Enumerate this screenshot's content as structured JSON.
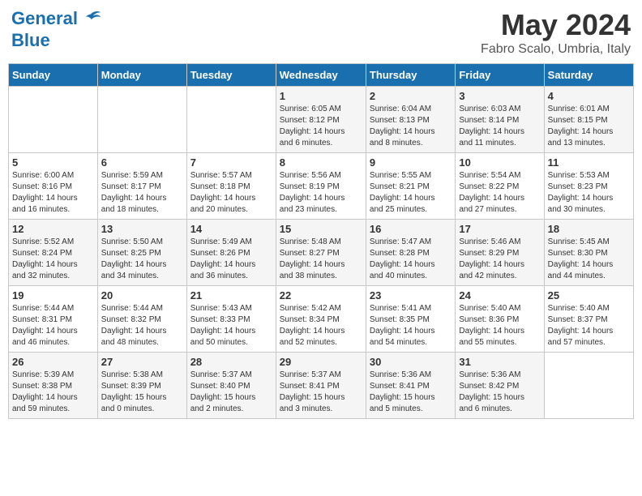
{
  "header": {
    "logo_line1": "General",
    "logo_line2": "Blue",
    "month": "May 2024",
    "location": "Fabro Scalo, Umbria, Italy"
  },
  "days_of_week": [
    "Sunday",
    "Monday",
    "Tuesday",
    "Wednesday",
    "Thursday",
    "Friday",
    "Saturday"
  ],
  "weeks": [
    [
      {
        "day": "",
        "info": ""
      },
      {
        "day": "",
        "info": ""
      },
      {
        "day": "",
        "info": ""
      },
      {
        "day": "1",
        "info": "Sunrise: 6:05 AM\nSunset: 8:12 PM\nDaylight: 14 hours\nand 6 minutes."
      },
      {
        "day": "2",
        "info": "Sunrise: 6:04 AM\nSunset: 8:13 PM\nDaylight: 14 hours\nand 8 minutes."
      },
      {
        "day": "3",
        "info": "Sunrise: 6:03 AM\nSunset: 8:14 PM\nDaylight: 14 hours\nand 11 minutes."
      },
      {
        "day": "4",
        "info": "Sunrise: 6:01 AM\nSunset: 8:15 PM\nDaylight: 14 hours\nand 13 minutes."
      }
    ],
    [
      {
        "day": "5",
        "info": "Sunrise: 6:00 AM\nSunset: 8:16 PM\nDaylight: 14 hours\nand 16 minutes."
      },
      {
        "day": "6",
        "info": "Sunrise: 5:59 AM\nSunset: 8:17 PM\nDaylight: 14 hours\nand 18 minutes."
      },
      {
        "day": "7",
        "info": "Sunrise: 5:57 AM\nSunset: 8:18 PM\nDaylight: 14 hours\nand 20 minutes."
      },
      {
        "day": "8",
        "info": "Sunrise: 5:56 AM\nSunset: 8:19 PM\nDaylight: 14 hours\nand 23 minutes."
      },
      {
        "day": "9",
        "info": "Sunrise: 5:55 AM\nSunset: 8:21 PM\nDaylight: 14 hours\nand 25 minutes."
      },
      {
        "day": "10",
        "info": "Sunrise: 5:54 AM\nSunset: 8:22 PM\nDaylight: 14 hours\nand 27 minutes."
      },
      {
        "day": "11",
        "info": "Sunrise: 5:53 AM\nSunset: 8:23 PM\nDaylight: 14 hours\nand 30 minutes."
      }
    ],
    [
      {
        "day": "12",
        "info": "Sunrise: 5:52 AM\nSunset: 8:24 PM\nDaylight: 14 hours\nand 32 minutes."
      },
      {
        "day": "13",
        "info": "Sunrise: 5:50 AM\nSunset: 8:25 PM\nDaylight: 14 hours\nand 34 minutes."
      },
      {
        "day": "14",
        "info": "Sunrise: 5:49 AM\nSunset: 8:26 PM\nDaylight: 14 hours\nand 36 minutes."
      },
      {
        "day": "15",
        "info": "Sunrise: 5:48 AM\nSunset: 8:27 PM\nDaylight: 14 hours\nand 38 minutes."
      },
      {
        "day": "16",
        "info": "Sunrise: 5:47 AM\nSunset: 8:28 PM\nDaylight: 14 hours\nand 40 minutes."
      },
      {
        "day": "17",
        "info": "Sunrise: 5:46 AM\nSunset: 8:29 PM\nDaylight: 14 hours\nand 42 minutes."
      },
      {
        "day": "18",
        "info": "Sunrise: 5:45 AM\nSunset: 8:30 PM\nDaylight: 14 hours\nand 44 minutes."
      }
    ],
    [
      {
        "day": "19",
        "info": "Sunrise: 5:44 AM\nSunset: 8:31 PM\nDaylight: 14 hours\nand 46 minutes."
      },
      {
        "day": "20",
        "info": "Sunrise: 5:44 AM\nSunset: 8:32 PM\nDaylight: 14 hours\nand 48 minutes."
      },
      {
        "day": "21",
        "info": "Sunrise: 5:43 AM\nSunset: 8:33 PM\nDaylight: 14 hours\nand 50 minutes."
      },
      {
        "day": "22",
        "info": "Sunrise: 5:42 AM\nSunset: 8:34 PM\nDaylight: 14 hours\nand 52 minutes."
      },
      {
        "day": "23",
        "info": "Sunrise: 5:41 AM\nSunset: 8:35 PM\nDaylight: 14 hours\nand 54 minutes."
      },
      {
        "day": "24",
        "info": "Sunrise: 5:40 AM\nSunset: 8:36 PM\nDaylight: 14 hours\nand 55 minutes."
      },
      {
        "day": "25",
        "info": "Sunrise: 5:40 AM\nSunset: 8:37 PM\nDaylight: 14 hours\nand 57 minutes."
      }
    ],
    [
      {
        "day": "26",
        "info": "Sunrise: 5:39 AM\nSunset: 8:38 PM\nDaylight: 14 hours\nand 59 minutes."
      },
      {
        "day": "27",
        "info": "Sunrise: 5:38 AM\nSunset: 8:39 PM\nDaylight: 15 hours\nand 0 minutes."
      },
      {
        "day": "28",
        "info": "Sunrise: 5:37 AM\nSunset: 8:40 PM\nDaylight: 15 hours\nand 2 minutes."
      },
      {
        "day": "29",
        "info": "Sunrise: 5:37 AM\nSunset: 8:41 PM\nDaylight: 15 hours\nand 3 minutes."
      },
      {
        "day": "30",
        "info": "Sunrise: 5:36 AM\nSunset: 8:41 PM\nDaylight: 15 hours\nand 5 minutes."
      },
      {
        "day": "31",
        "info": "Sunrise: 5:36 AM\nSunset: 8:42 PM\nDaylight: 15 hours\nand 6 minutes."
      },
      {
        "day": "",
        "info": ""
      }
    ]
  ]
}
